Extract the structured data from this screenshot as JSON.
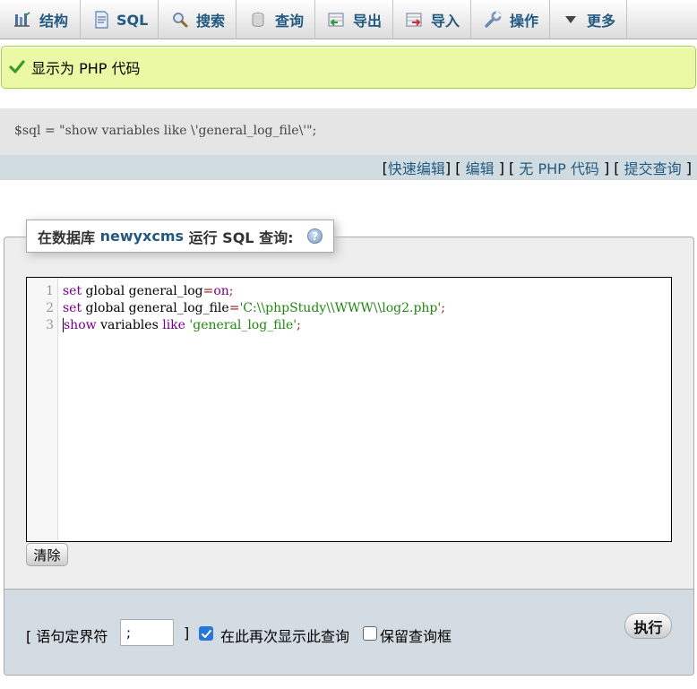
{
  "tabs": [
    {
      "label": "结构",
      "icon": "structure-icon"
    },
    {
      "label": "SQL",
      "icon": "sql-icon"
    },
    {
      "label": "搜索",
      "icon": "search-icon"
    },
    {
      "label": "查询",
      "icon": "query-icon"
    },
    {
      "label": "导出",
      "icon": "export-icon"
    },
    {
      "label": "导入",
      "icon": "import-icon"
    },
    {
      "label": "操作",
      "icon": "wrench-icon"
    },
    {
      "label": "更多",
      "icon": "chevron-down-icon"
    }
  ],
  "message": {
    "text": "显示为 PHP 代码",
    "color": "#ebf8a4"
  },
  "sql_display": {
    "code": "$sql = \"show variables like \\'general_log_file\\'\";",
    "links": {
      "open": "[",
      "quick_edit": "快速编辑",
      "sep1": "] [",
      "edit": "编辑",
      "sep2": "] [",
      "no_php": "无 PHP 代码",
      "sep3": "] [",
      "submit": "提交查询",
      "close": "]"
    }
  },
  "query_panel": {
    "legend_prefix": "在数据库 ",
    "database": "newyxcms",
    "legend_suffix": " 运行 SQL 查询: ",
    "help_glyph": "?",
    "editor_lines": [
      {
        "num": "1",
        "text": "set global general_log=on;"
      },
      {
        "num": "2",
        "text": "set global general_log_file='C:\\\\phpStudy\\\\WWW\\\\log2.php';"
      },
      {
        "num": "3",
        "text": "show variables like 'general_log_file';"
      }
    ],
    "clear_label": "清除"
  },
  "footer": {
    "delimiter_label": "[ 语句定界符",
    "delimiter_value": ";",
    "delimiter_close": "]",
    "show_again_label": "在此再次显示此查询",
    "show_again_checked": true,
    "retain_box_label": "保留查询框",
    "retain_box_checked": false,
    "go_label": "执行"
  },
  "colors": {
    "link": "#235a81",
    "success_bg": "#ebf8a4",
    "checkbox_on": "#2677d9"
  }
}
